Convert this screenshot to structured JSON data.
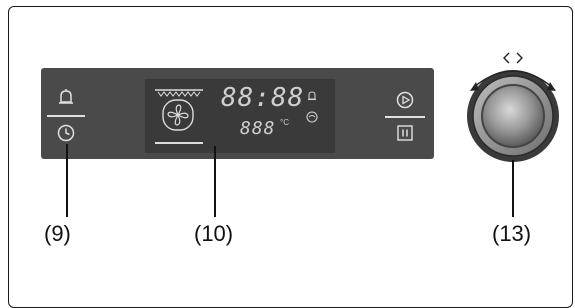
{
  "display": {
    "time_digits": "88:88",
    "temp_digits": "888"
  },
  "callouts": {
    "left_buttons": "(9)",
    "display": "(10)",
    "knob": "(13)"
  },
  "colors": {
    "panel": "#4a4a4a",
    "display": "#3a3a3a",
    "segments": "#cfcfcf"
  },
  "icons": {
    "left_top": "bell-icon",
    "left_bottom": "clock-icon",
    "right_top": "play-icon",
    "right_bottom": "pause-icon",
    "display_fan": "fan-icon",
    "display_bell": "bell-icon",
    "display_food": "food-probe-icon",
    "knob_arrows": "rotate-arrows-icon"
  }
}
